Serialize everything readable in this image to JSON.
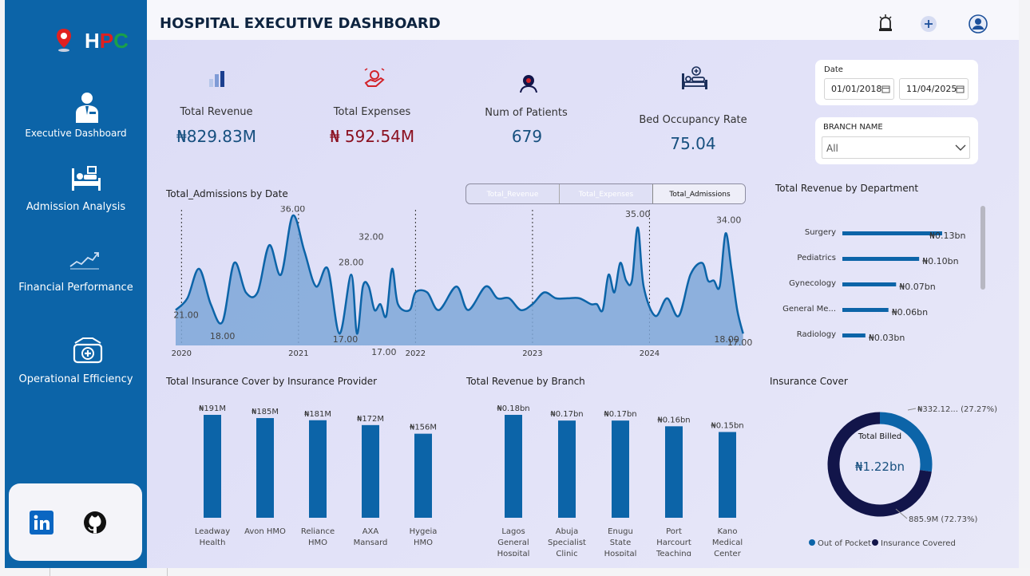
{
  "header": {
    "title": "HOSPITAL EXECUTIVE DASHBOARD"
  },
  "logo": {
    "letter1": "H",
    "letter2": "P",
    "letter3": "C"
  },
  "sidebar": {
    "items": [
      {
        "label": "Executive Dashboard",
        "icon": "doctor-icon"
      },
      {
        "label": "Admission Analysis",
        "icon": "hospital-bed-icon"
      },
      {
        "label": "Financial Performance",
        "icon": "trend-chart-icon"
      },
      {
        "label": "Operational Efficiency",
        "icon": "medical-kit-icon"
      }
    ]
  },
  "kpis": {
    "revenue": {
      "label": "Total Revenue",
      "value": "₦829.83M"
    },
    "expenses": {
      "label": "Total Expenses",
      "value": "₦ 592.54M"
    },
    "patients": {
      "label": "Num of Patients",
      "value": "679"
    },
    "occupancy": {
      "label": "Bed Occupancy Rate",
      "value": "75.04"
    }
  },
  "filters": {
    "date_label": "Date",
    "date_start": "01/01/2018",
    "date_end": "11/04/2025",
    "branch_label": "BRANCH NAME",
    "branch_value": "All"
  },
  "toggle": {
    "revenue": "Total_Revenue",
    "expenses": "Total_Expenses",
    "admissions": "Total_Admissions"
  },
  "colors": {
    "primary": "#0c64a8",
    "revenue_value": "#17507f",
    "expense_value": "#8b1020",
    "dark_navy": "#12154a"
  },
  "admissions_chart": {
    "title": "Total_Admissions by Date",
    "x_labels": [
      "2020",
      "2021",
      "2022",
      "2023",
      "2024"
    ],
    "data_labels": [
      "21.00",
      "18.00",
      "36.00",
      "28.00",
      "32.00",
      "17.00",
      "17.00",
      "35.00",
      "34.00",
      "18.00",
      "17.00"
    ]
  },
  "dept_chart": {
    "title": "Total Revenue by Department",
    "labels": [
      "Surgery",
      "Pediatrics",
      "Gynecology",
      "General Me...",
      "Radiology"
    ],
    "values_text": [
      "₦0.13bn",
      "₦0.10bn",
      "₦0.07bn",
      "₦0.06bn",
      "₦0.03bn"
    ]
  },
  "insurance_chart": {
    "title": "Total Insurance Cover by Insurance Provider",
    "labels": [
      "Leadway Health",
      "Avon HMO",
      "Reliance HMO",
      "AXA Mansard",
      "Hygeia HMO"
    ],
    "values_text": [
      "₦191M",
      "₦185M",
      "₦181M",
      "₦172M",
      "₦156M"
    ]
  },
  "branch_chart": {
    "title": "Total Revenue by Branch",
    "labels": [
      "Lagos General Hospital",
      "Abuja Specialist Clinic",
      "Enugu State Hospital",
      "Port Harcourt Teaching ...",
      "Kano Medical Center"
    ],
    "values_text": [
      "₦0.18bn",
      "₦0.17bn",
      "₦0.17bn",
      "₦0.16bn",
      "₦0.15bn"
    ]
  },
  "donut": {
    "title": "Insurance Cover",
    "center_label": "Total Billed",
    "center_value": "₦1.22bn",
    "slice_oop": "₦332.12... (27.27%)",
    "slice_ins": "885.9M (72.73%)",
    "legend_oop": "Out of Pocket",
    "legend_ins": "Insurance Covered"
  },
  "chart_data": [
    {
      "type": "area",
      "title": "Total_Admissions by Date",
      "x": [
        2019.95,
        2020.05,
        2020.15,
        2020.25,
        2020.35,
        2020.45,
        2020.55,
        2020.65,
        2020.75,
        2020.85,
        2020.95,
        2021.05,
        2021.15,
        2021.25,
        2021.35,
        2021.45,
        2021.5,
        2021.55,
        2021.6,
        2021.65,
        2021.7,
        2021.75,
        2021.8,
        2021.85,
        2021.95,
        2022.0,
        2022.1,
        2022.2,
        2022.35,
        2022.45,
        2022.6,
        2022.7,
        2022.8,
        2022.9,
        2023.0,
        2023.1,
        2023.2,
        2023.3,
        2023.4,
        2023.5,
        2023.55,
        2023.6,
        2023.65,
        2023.7,
        2023.75,
        2023.8,
        2023.85,
        2023.9,
        2023.95,
        2024.05,
        2024.15,
        2024.25,
        2024.35,
        2024.45,
        2024.5,
        2024.55,
        2024.6,
        2024.65,
        2024.7,
        2024.75,
        2024.8
      ],
      "values": [
        21,
        23,
        28,
        22,
        19,
        29,
        24,
        24,
        32,
        27,
        37,
        31,
        25,
        28,
        17,
        27,
        17,
        25,
        25,
        21,
        22,
        20,
        28,
        22,
        21,
        24,
        24,
        21,
        25,
        21,
        25,
        23,
        23,
        21,
        22,
        24,
        23,
        23,
        23,
        22,
        22,
        21,
        27,
        24,
        29,
        26,
        26,
        35,
        25,
        20,
        23,
        20,
        27,
        29,
        26,
        26,
        25,
        34,
        28,
        21,
        17
      ],
      "xlim": [
        2019.95,
        2024.85
      ],
      "ylim": [
        15,
        38
      ]
    },
    {
      "type": "bar",
      "title": "Total Revenue by Department",
      "categories": [
        "Surgery",
        "Pediatrics",
        "Gynecology",
        "General Me...",
        "Radiology"
      ],
      "values": [
        0.13,
        0.1,
        0.07,
        0.06,
        0.03
      ]
    },
    {
      "type": "bar",
      "title": "Total Insurance Cover by Insurance Provider",
      "categories": [
        "Leadway Health",
        "Avon HMO",
        "Reliance HMO",
        "AXA Mansard",
        "Hygeia HMO"
      ],
      "values": [
        191,
        185,
        181,
        172,
        156
      ]
    },
    {
      "type": "bar",
      "title": "Total Revenue by Branch",
      "categories": [
        "Lagos General Hospital",
        "Abuja Specialist Clinic",
        "Enugu State Hospital",
        "Port Harcourt Teaching ...",
        "Kano Medical Center"
      ],
      "values": [
        0.18,
        0.17,
        0.17,
        0.16,
        0.15
      ]
    },
    {
      "type": "pie",
      "title": "Insurance Cover",
      "categories": [
        "Out of Pocket",
        "Insurance Covered"
      ],
      "values": [
        27.27,
        72.73
      ]
    }
  ]
}
